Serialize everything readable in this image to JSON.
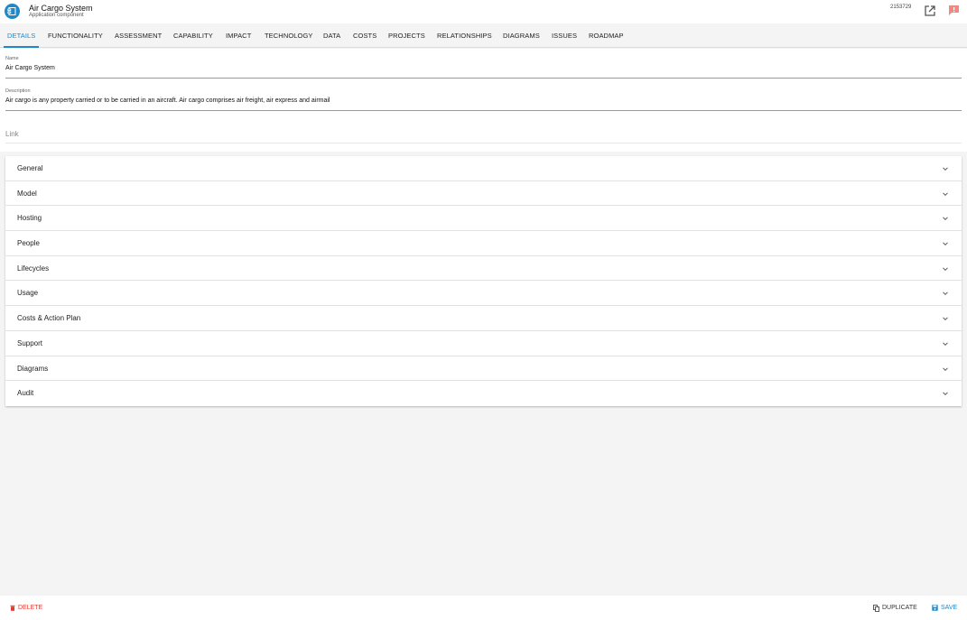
{
  "header": {
    "title": "Air Cargo System",
    "subtitle": "Application component",
    "record_id": "2153729",
    "app_icon": "application-component-icon",
    "actions": [
      "open-external-icon",
      "alert-icon"
    ],
    "colors": {
      "accent": "#1e88c8",
      "alert": "#f08a80"
    }
  },
  "tabs": [
    {
      "label": "DETAILS",
      "active": true
    },
    {
      "label": "FUNCTIONALITY"
    },
    {
      "label": "ASSESSMENT"
    },
    {
      "label": "CAPABILITY"
    },
    {
      "label": "IMPACT"
    },
    {
      "label": "TECHNOLOGY"
    },
    {
      "label": "DATA"
    },
    {
      "label": "COSTS"
    },
    {
      "label": "PROJECTS"
    },
    {
      "label": "RELATIONSHIPS"
    },
    {
      "label": "DIAGRAMS"
    },
    {
      "label": "ISSUES"
    },
    {
      "label": "ROADMAP"
    }
  ],
  "form": {
    "name_label": "Name",
    "name_value": "Air Cargo System",
    "description_label": "Description",
    "description_value": "Air cargo is any property carried or to be carried in an aircraft. Air cargo comprises air freight, air express and airmail",
    "link_placeholder": "Link"
  },
  "sections": [
    {
      "label": "General"
    },
    {
      "label": "Model"
    },
    {
      "label": "Hosting"
    },
    {
      "label": "People"
    },
    {
      "label": "Lifecycles"
    },
    {
      "label": "Usage"
    },
    {
      "label": "Costs & Action Plan"
    },
    {
      "label": "Support"
    },
    {
      "label": "Diagrams"
    },
    {
      "label": "Audit"
    }
  ],
  "footer": {
    "delete_label": "DELETE",
    "duplicate_label": "DUPLICATE",
    "save_label": "SAVE",
    "colors": {
      "delete": "#e03b2f",
      "save": "#1e88c8"
    }
  }
}
